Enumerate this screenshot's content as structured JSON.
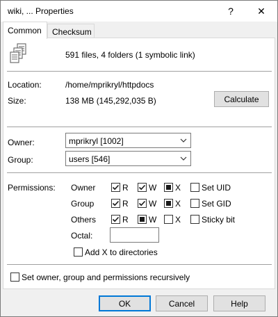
{
  "window": {
    "title": "wiki, ... Properties",
    "help_glyph": "?",
    "close_glyph": "✕"
  },
  "tabs": [
    {
      "label": "Common",
      "active": true
    },
    {
      "label": "Checksum",
      "active": false
    }
  ],
  "summary": {
    "icon": "files-icon",
    "text": "591 files, 4 folders (1 symbolic link)"
  },
  "location": {
    "label": "Location:",
    "value": "/home/mprikryl/httpdocs"
  },
  "size": {
    "label": "Size:",
    "value": "138 MB (145,292,035 B)",
    "calculate_label": "Calculate"
  },
  "owner": {
    "label": "Owner:",
    "value": "mprikryl [1002]"
  },
  "group": {
    "label": "Group:",
    "value": "users [546]"
  },
  "permissions": {
    "label": "Permissions:",
    "rows": [
      {
        "name": "Owner",
        "r_label": "R",
        "w_label": "W",
        "x_label": "X",
        "r": "checked",
        "w": "checked",
        "x": "indeterminate",
        "extra_label": "Set UID",
        "extra": "unchecked"
      },
      {
        "name": "Group",
        "r_label": "R",
        "w_label": "W",
        "x_label": "X",
        "r": "checked",
        "w": "checked",
        "x": "indeterminate",
        "extra_label": "Set GID",
        "extra": "unchecked"
      },
      {
        "name": "Others",
        "r_label": "R",
        "w_label": "W",
        "x_label": "X",
        "r": "checked",
        "w": "indeterminate",
        "x": "unchecked",
        "extra_label": "Sticky bit",
        "extra": "unchecked"
      }
    ],
    "octal_label": "Octal:",
    "octal_value": "",
    "add_x_label": "Add X to directories",
    "add_x": "unchecked"
  },
  "recursive": {
    "label": "Set owner, group and permissions recursively",
    "state": "unchecked"
  },
  "buttons": {
    "ok": "OK",
    "cancel": "Cancel",
    "help": "Help"
  },
  "colors": {
    "default_button_border": "#0078d7",
    "panel": "#ffffff",
    "chrome": "#f0f0f0"
  }
}
